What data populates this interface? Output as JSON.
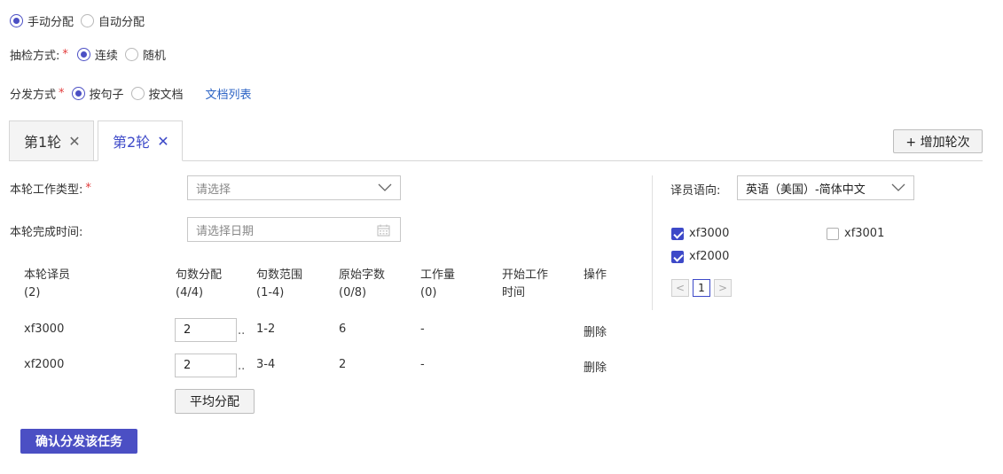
{
  "assign_mode": {
    "manual": "手动分配",
    "auto": "自动分配",
    "selected": "manual"
  },
  "inspect": {
    "label": "抽检方式:",
    "required": "*",
    "continuous": "连续",
    "random": "随机",
    "selected": "continuous"
  },
  "dispatch": {
    "label": "分发方式",
    "required": "*",
    "by_sentence": "按句子",
    "by_document": "按文档",
    "doc_list_link": "文档列表",
    "selected": "by_sentence"
  },
  "tabs": [
    {
      "label": "第1轮",
      "close": "✕",
      "active": false
    },
    {
      "label": "第2轮",
      "close": "✕",
      "active": true
    }
  ],
  "add_round_button": "+ 增加轮次",
  "work_type": {
    "label": "本轮工作类型:",
    "required": "*",
    "placeholder": "请选择"
  },
  "finish_time": {
    "label": "本轮完成时间:",
    "placeholder": "请选择日期"
  },
  "table": {
    "headers": [
      {
        "line1": "本轮译员",
        "line2": "(2)"
      },
      {
        "line1": "句数分配",
        "line2": "(4/4)"
      },
      {
        "line1": "句数范围",
        "line2": "(1-4)"
      },
      {
        "line1": "原始字数",
        "line2": "(0/8)"
      },
      {
        "line1": "工作量",
        "line2": "(0)"
      },
      {
        "line1": "开始工作",
        "line2": "时间"
      },
      {
        "line1": "操作",
        "line2": ""
      }
    ],
    "rows": [
      {
        "translator": "xf3000",
        "sentences": "2",
        "range": "1-2",
        "words": "6",
        "workload": "-",
        "action": "删除"
      },
      {
        "translator": "xf2000",
        "sentences": "2",
        "range": "3-4",
        "words": "2",
        "workload": "-",
        "action": "删除"
      }
    ],
    "ellipsis": ".."
  },
  "average_button": "平均分配",
  "language": {
    "label": "译员语向:",
    "value": "英语（美国）-简体中文"
  },
  "translators": [
    {
      "name": "xf3000",
      "checked": true
    },
    {
      "name": "xf3001",
      "checked": false
    },
    {
      "name": "xf2000",
      "checked": true
    }
  ],
  "pagination": {
    "prev": "<",
    "current": "1",
    "next": ">"
  },
  "confirm_button": "确认分发该任务",
  "colors": {
    "primary": "#4b4fc4",
    "link": "#2b63c5",
    "required": "#e23c3c"
  }
}
